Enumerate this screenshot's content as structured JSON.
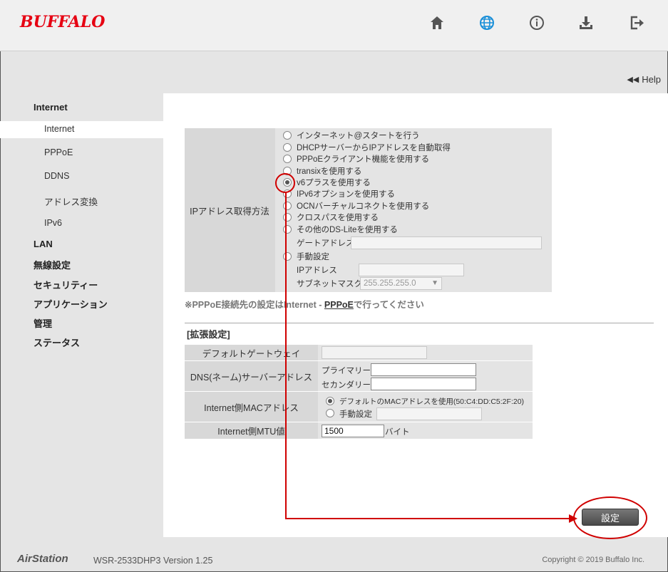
{
  "header": {
    "logo": "BUFFALO",
    "icons": [
      "home-icon",
      "globe-icon",
      "info-icon",
      "download-icon",
      "logout-icon"
    ],
    "accent_color": "#e60012",
    "active_icon_color": "#1a8fd8"
  },
  "help": {
    "label": "Help"
  },
  "sidebar": {
    "internet": "Internet",
    "sub": [
      "Internet",
      "PPPoE",
      "DDNS",
      "アドレス変換",
      "IPv6"
    ],
    "lan": "LAN",
    "wireless": "無線設定",
    "security": "セキュリティー",
    "application": "アプリケーション",
    "admin": "管理",
    "status": "ステータス"
  },
  "ip": {
    "label": "IPアドレス取得方法",
    "options": [
      "インターネット@スタートを行う",
      "DHCPサーバーからIPアドレスを自動取得",
      "PPPoEクライアント機能を使用する",
      "transixを使用する",
      "v6プラスを使用する",
      "IPv6オプションを使用する",
      "OCNバーチャルコネクトを使用する",
      "クロスパスを使用する",
      "その他のDS-Liteを使用する"
    ],
    "selected_index": 4,
    "gateway_label": "ゲートアドレス",
    "manual_label": "手動設定",
    "ip_address_label": "IPアドレス",
    "subnet_label": "サブネットマスク",
    "subnet_value": "255.255.255.0"
  },
  "note": {
    "prefix": "※PPPoE接続先の設定はInternet - ",
    "link": "PPPoE",
    "suffix": "で行ってください"
  },
  "extended": {
    "title": "[拡張設定]",
    "default_gateway_label": "デフォルトゲートウェイ",
    "dns_label": "DNS(ネーム)サーバーアドレス",
    "primary_label": "プライマリー:",
    "secondary_label": "セカンダリー:",
    "mac_label": "Internet側MACアドレス",
    "mac_default_label": "デフォルトのMACアドレスを使用(50:C4:DD:C5:2F:20)",
    "mac_manual_label": "手動設定",
    "mtu_label": "Internet側MTU値",
    "mtu_value": "1500",
    "mtu_unit": "バイト"
  },
  "actions": {
    "set_label": "設定"
  },
  "footer": {
    "brand": "AirStation",
    "model": "WSR-2533DHP3  Version 1.25",
    "copyright": "Copyright © 2019 Buffalo Inc."
  }
}
